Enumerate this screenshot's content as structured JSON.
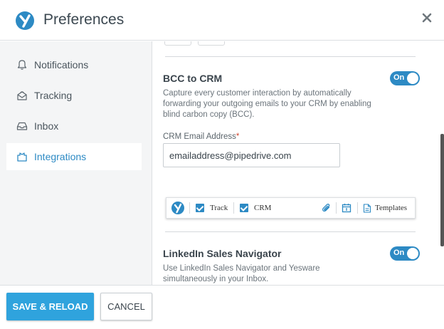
{
  "header": {
    "title": "Preferences",
    "logo_icon": "yesware-logo",
    "close_icon": "close-icon"
  },
  "sidebar": {
    "items": [
      {
        "label": "Notifications",
        "icon": "bell-icon",
        "active": false
      },
      {
        "label": "Tracking",
        "icon": "tracking-icon",
        "active": false
      },
      {
        "label": "Inbox",
        "icon": "inbox-icon",
        "active": false
      },
      {
        "label": "Integrations",
        "icon": "integrations-icon",
        "active": true
      }
    ]
  },
  "bcc": {
    "title": "BCC to CRM",
    "toggle": "On",
    "description": "Capture every customer interaction by automatically forwarding your outgoing emails to your CRM by enabling blind carbon copy (BCC).",
    "field_label": "CRM Email Address",
    "required_mark": "*",
    "email_value": "emailaddress@pipedrive.com"
  },
  "toolbar": {
    "track_label": "Track",
    "crm_label": "CRM",
    "templates_label": "Templates",
    "track_checked": true,
    "crm_checked": true
  },
  "linkedin": {
    "title": "LinkedIn Sales Navigator",
    "toggle": "On",
    "description": "Use LinkedIn Sales Navigator and Yesware simultaneously in your Inbox."
  },
  "footer": {
    "save_label": "SAVE & RELOAD",
    "cancel_label": "CANCEL"
  },
  "colors": {
    "accent": "#2d8ac4",
    "save_button": "#2fa3dd",
    "required": "#d0462f"
  }
}
